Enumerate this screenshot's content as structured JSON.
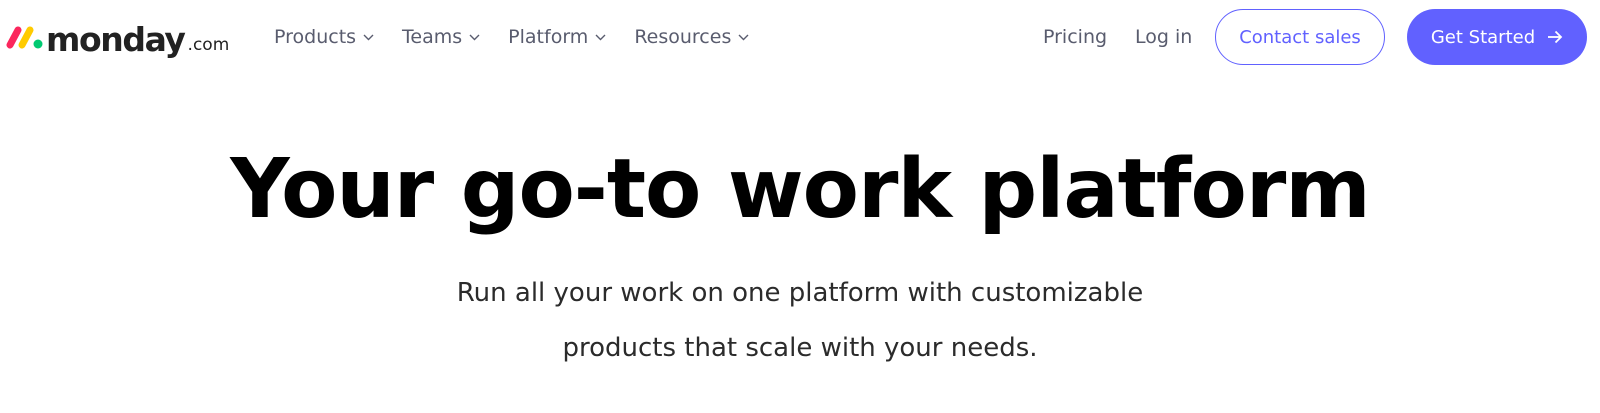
{
  "brand": {
    "name": "monday",
    "suffix": ".com",
    "colors": {
      "red": "#fb275d",
      "yellow": "#ffcb00",
      "green": "#00ca72",
      "accent": "#6161ff"
    }
  },
  "nav": {
    "menu": [
      {
        "label": "Products",
        "icon": "chevron-down-icon"
      },
      {
        "label": "Teams",
        "icon": "chevron-down-icon"
      },
      {
        "label": "Platform",
        "icon": "chevron-down-icon"
      },
      {
        "label": "Resources",
        "icon": "chevron-down-icon"
      }
    ],
    "pricing": "Pricing",
    "login": "Log in",
    "contact_sales": "Contact sales",
    "get_started": "Get Started",
    "get_started_icon": "arrow-right-icon"
  },
  "hero": {
    "title": "Your go-to work platform",
    "subtitle_line1": "Run all your work on one platform with customizable",
    "subtitle_line2": "products that scale with your needs."
  }
}
